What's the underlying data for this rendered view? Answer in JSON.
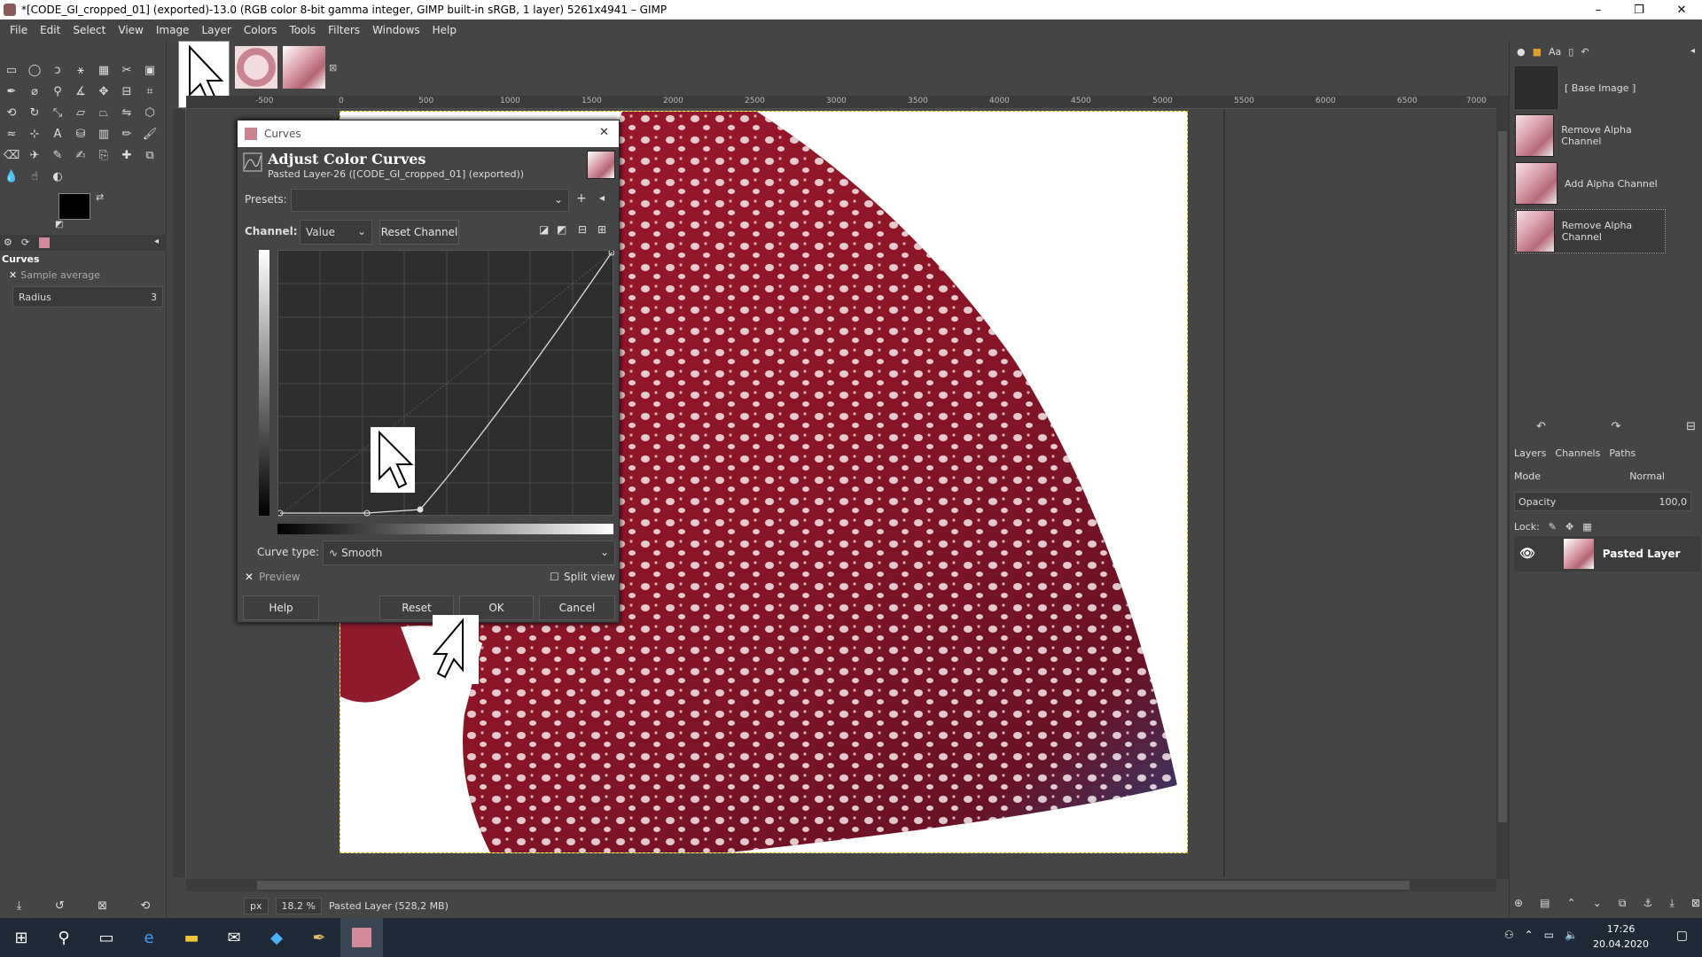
{
  "window": {
    "title": "*[CODE_GI_cropped_01] (exported)-13.0 (RGB color 8-bit gamma integer, GIMP built-in sRGB, 1 layer) 5261x4941 – GIMP",
    "minimize": "–",
    "maximize": "❐",
    "close": "✕"
  },
  "menu": [
    "File",
    "Edit",
    "Select",
    "View",
    "Image",
    "Layer",
    "Colors",
    "Tools",
    "Filters",
    "Windows",
    "Help"
  ],
  "tool_options": {
    "title": "Curves",
    "sample_average": "Sample average",
    "radius_label": "Radius",
    "radius_value": "3"
  },
  "ruler": {
    "h_ticks": [
      "-500",
      "0",
      "500",
      "1000",
      "1500",
      "2000",
      "2500",
      "3000",
      "3500",
      "4000",
      "4500",
      "5000",
      "5500",
      "6000",
      "6500",
      "7000"
    ]
  },
  "status": {
    "unit": "px",
    "zoom": "18.2 %",
    "layer_info": "Pasted Layer (528,2 MB)"
  },
  "curves": {
    "window_title": "Curves",
    "heading": "Adjust Color Curves",
    "subheading": "Pasted Layer-26 ([CODE_GI_cropped_01] (exported))",
    "presets_label": "Presets:",
    "presets_value": "",
    "channel_label": "Channel:",
    "channel_value": "Value",
    "reset_channel": "Reset Channel",
    "curve_type_label": "Curve type:",
    "curve_type_value": "Smooth",
    "preview_label": "Preview",
    "split_view_label": "Split view",
    "help": "Help",
    "reset": "Reset",
    "ok": "OK",
    "cancel": "Cancel"
  },
  "undo_history": [
    {
      "label": "[ Base Image ]"
    },
    {
      "label": "Remove Alpha Channel"
    },
    {
      "label": "Add Alpha Channel"
    },
    {
      "label": "Remove Alpha Channel"
    }
  ],
  "layers_panel": {
    "tabs": [
      "Layers",
      "Channels",
      "Paths"
    ],
    "mode_label": "Mode",
    "mode_value": "Normal",
    "opacity_label": "Opacity",
    "opacity_value": "100,0",
    "lock_label": "Lock:",
    "layer_name": "Pasted Layer"
  },
  "taskbar": {
    "time": "17:26",
    "date": "20.04.2020"
  }
}
